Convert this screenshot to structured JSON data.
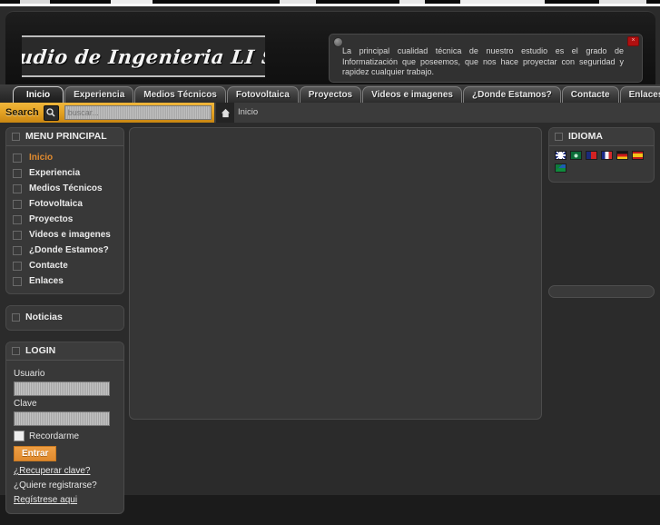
{
  "header": {
    "logo_text": "Estudio de Ingenieria LI S.L.",
    "notice": {
      "text": "La principal cualidad técnica de nuestro  estudio  es   el   grado   de Informatización que poseemos, que nos hace proyectar con seguridad y rapidez cualquier trabajo.",
      "close_label": "×",
      "dot_icon": "bullet-icon"
    }
  },
  "nav": {
    "tabs": [
      {
        "label": "Inicio",
        "active": true
      },
      {
        "label": "Experiencia",
        "active": false
      },
      {
        "label": "Medios Técnicos",
        "active": false
      },
      {
        "label": "Fotovoltaica",
        "active": false
      },
      {
        "label": "Proyectos",
        "active": false
      },
      {
        "label": "Videos e imagenes",
        "active": false
      },
      {
        "label": "¿Donde Estamos?",
        "active": false
      },
      {
        "label": "Contacte",
        "active": false
      },
      {
        "label": "Enlaces",
        "active": false
      }
    ]
  },
  "search": {
    "label": "Search",
    "icon": "magnifier-icon",
    "value": "",
    "placeholder": "buscar...",
    "accent_color": "#e5a425"
  },
  "breadcrumb": {
    "home_icon": "home-icon",
    "current": "Inicio"
  },
  "sidebar_left": {
    "menu": {
      "title": "MENU PRINCIPAL",
      "items": [
        {
          "label": "Inicio",
          "active": true
        },
        {
          "label": "Experiencia",
          "active": false
        },
        {
          "label": "Medios Técnicos",
          "active": false
        },
        {
          "label": "Fotovoltaica",
          "active": false
        },
        {
          "label": "Proyectos",
          "active": false
        },
        {
          "label": "Videos e imagenes",
          "active": false
        },
        {
          "label": "¿Donde Estamos?",
          "active": false
        },
        {
          "label": "Contacte",
          "active": false
        },
        {
          "label": "Enlaces",
          "active": false
        }
      ]
    },
    "news": {
      "title": "Noticias"
    },
    "login": {
      "title": "LOGIN",
      "user_label": "Usuario",
      "user_value": "",
      "pass_label": "Clave",
      "pass_value": "",
      "remember_label": "Recordarme",
      "submit_label": "Entrar",
      "link_recover": "¿Recuperar clave?",
      "link_register_question": "¿Quiere registrarse?",
      "link_register": "Regístrese aqui"
    }
  },
  "sidebar_right": {
    "language": {
      "title": "IDIOMA",
      "flags": [
        {
          "name": "flag-uk-icon",
          "class": "f-uk",
          "title": "English"
        },
        {
          "name": "flag-saudi-arabia-icon",
          "class": "f-sa",
          "title": "العربية"
        },
        {
          "name": "flag-taiwan-icon",
          "class": "f-tw",
          "title": "中文"
        },
        {
          "name": "flag-france-icon",
          "class": "f-fr",
          "title": "Français"
        },
        {
          "name": "flag-germany-icon",
          "class": "f-de",
          "title": "Deutsch"
        },
        {
          "name": "flag-spain-icon",
          "class": "f-es",
          "title": "Español"
        },
        {
          "name": "flag-south-africa-icon",
          "class": "f-za",
          "title": "Afrikaans"
        }
      ]
    }
  },
  "main": {
    "content": ""
  },
  "colors": {
    "page_background": "#2b2b2b",
    "module_background": "#383838",
    "content_background": "#363636",
    "accent": "#e08a2e",
    "search_bar": "#e5a425"
  }
}
